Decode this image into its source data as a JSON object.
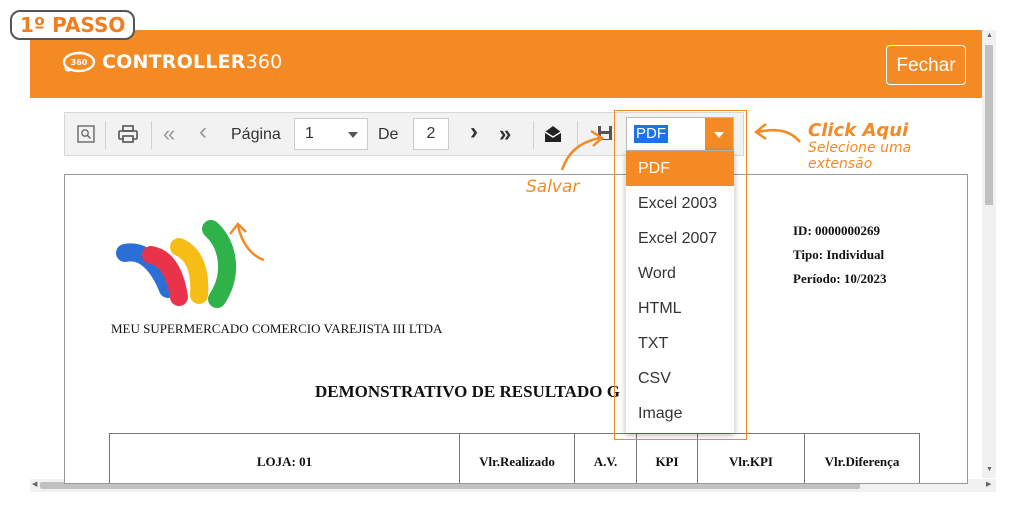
{
  "step_badge": "1º PASSO",
  "app": {
    "brand_bold": "CONTROLLER",
    "brand_light": "360",
    "logo_badge": "360",
    "close_label": "Fechar",
    "header_color": "#f38a24"
  },
  "toolbar": {
    "icons": [
      "search-icon",
      "print-icon",
      "first-page-icon",
      "prev-page-icon",
      "next-page-icon",
      "last-page-icon",
      "email-icon",
      "save-icon"
    ],
    "page_label": "Página",
    "current_page": "1",
    "of_label": "De",
    "total_pages": "2",
    "format_selected": "PDF"
  },
  "format_options": [
    "PDF",
    "Excel 2003",
    "Excel 2007",
    "Word",
    "HTML",
    "TXT",
    "CSV",
    "Image"
  ],
  "annotations": {
    "click_here": "Click Aqui",
    "select_extension": "Selecione uma extensão",
    "save": "Salvar"
  },
  "report": {
    "id_line": "ID: 0000000269",
    "type_line": "Tipo: Individual",
    "period_line": "Período: 10/2023",
    "company": "MEU SUPERMERCADO COMERCIO VAREJISTA III LTDA",
    "title": "DEMONSTRATIVO DE RESULTADO G",
    "columns": [
      "LOJA: 01",
      "Vlr.Realizado",
      "A.V.",
      "KPI",
      "Vlr.KPI",
      "Vlr.Diferença"
    ]
  }
}
